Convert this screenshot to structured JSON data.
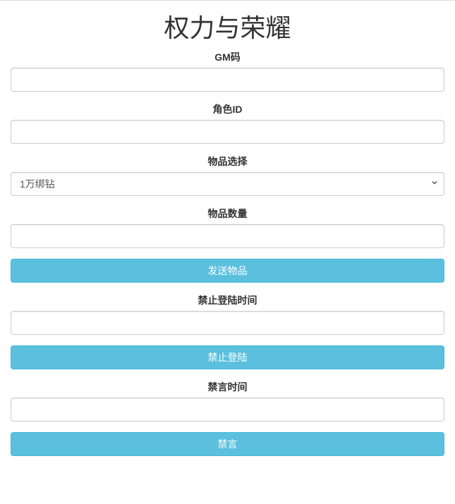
{
  "page": {
    "title": "权力与荣耀"
  },
  "form": {
    "gm_code": {
      "label": "GM码",
      "value": ""
    },
    "role_id": {
      "label": "角色ID",
      "value": ""
    },
    "item_select": {
      "label": "物品选择",
      "selected": "1万绑钻"
    },
    "item_count": {
      "label": "物品数量",
      "value": ""
    },
    "ban_login_time": {
      "label": "禁止登陆时间",
      "value": ""
    },
    "mute_time": {
      "label": "禁言时间",
      "value": ""
    }
  },
  "buttons": {
    "send_item": "发送物品",
    "ban_login": "禁止登陆",
    "mute": "禁言"
  }
}
